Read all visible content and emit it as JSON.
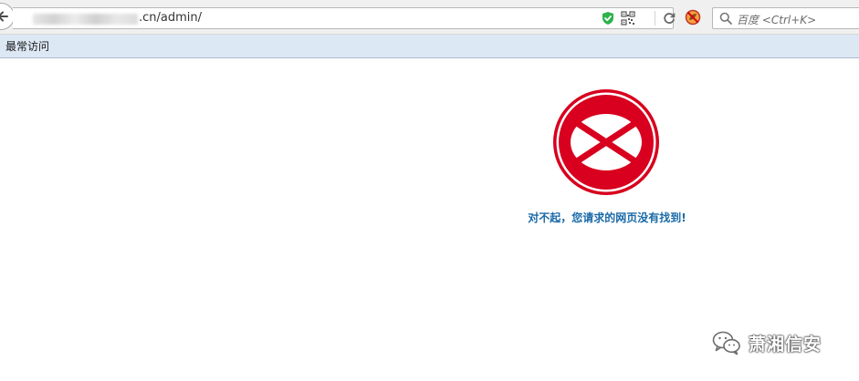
{
  "browser": {
    "url": ".cn/admin/",
    "search_placeholder": "百度 <Ctrl+K>",
    "icons": {
      "back": "back-arrow-icon",
      "shield": "shield-check-icon",
      "qr": "qr-code-icon",
      "reload": "reload-icon",
      "extension": "blocked-extension-icon",
      "search": "search-icon"
    }
  },
  "bookmarks": {
    "items": [
      {
        "label": "最常访问"
      }
    ]
  },
  "error_page": {
    "icon": "no-entry-icon",
    "message": "对不起，您请求的网页没有找到!",
    "colors": {
      "icon_red": "#d8001e",
      "message_blue": "#1a6aa8"
    }
  },
  "watermark": {
    "icon": "wechat-icon",
    "text": "萧湘信安"
  }
}
